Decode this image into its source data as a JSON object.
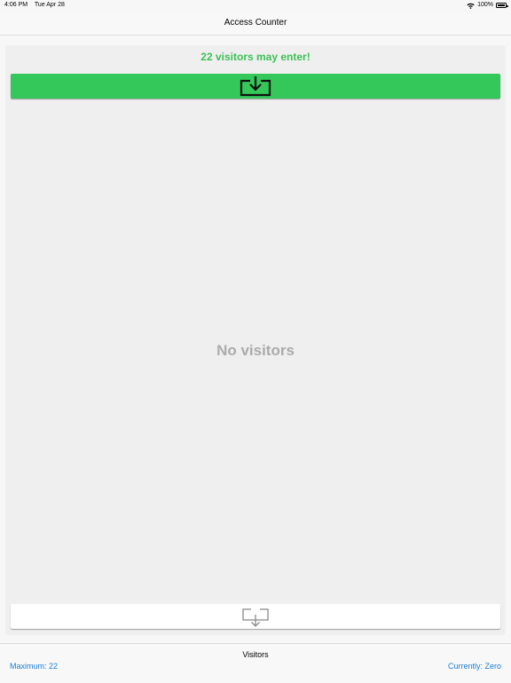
{
  "status_bar": {
    "time": "4:06 PM",
    "date": "Tue Apr 28",
    "battery_percent": "100%",
    "battery_level": 1.0,
    "icons": [
      "wifi-icon",
      "battery-icon"
    ]
  },
  "nav": {
    "title": "Access Counter"
  },
  "main": {
    "status_message": "22 visitors may enter!",
    "empty_text": "No visitors",
    "enter_button_icon": "tray-arrow-down-icon",
    "exit_button_icon": "tray-arrow-up-icon"
  },
  "toolbar": {
    "title": "Visitors",
    "maximum_label": "Maximum: 22",
    "current_label": "Currently: Zero"
  },
  "colors": {
    "accent_green": "#34c759",
    "status_text_green": "#3cc154",
    "link_blue": "#1a7ed6",
    "empty_text_gray": "#ababab"
  }
}
